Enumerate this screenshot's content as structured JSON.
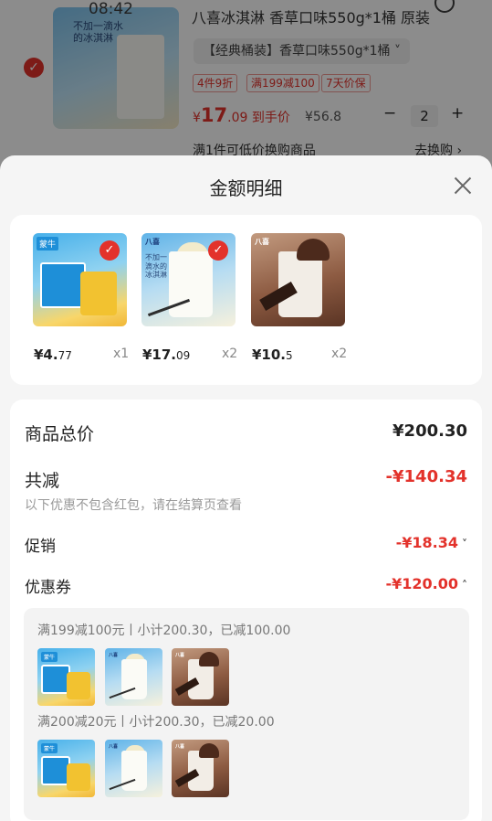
{
  "status_bar": {
    "time": "08:42"
  },
  "background_cart": {
    "product_title": "八喜冰淇淋 香草口味550g*1桶 原装",
    "variant": "【经典桶装】香草口味550g*1桶",
    "tags": [
      "4件9折",
      "满199减100",
      "7天价保"
    ],
    "price_currency": "¥",
    "price_int": "17",
    "price_dec": ".09",
    "price_suffix": "到手价",
    "original_price": "¥56.8",
    "stepper_minus": "−",
    "quantity": "2",
    "stepper_plus": "+",
    "exchange_text": "满1件可低价换购商品",
    "exchange_link": "去换购 ›",
    "thumb_text": "不加一滴水的冰淇淋",
    "thumb_brand": "八喜"
  },
  "sheet": {
    "title": "金额明细",
    "products": [
      {
        "price_int": "¥4.",
        "price_dec": "77",
        "qty": "x1",
        "brand": "蒙牛"
      },
      {
        "price_int": "¥17.",
        "price_dec": "09",
        "qty": "x2",
        "brand": "八喜",
        "text": "不加一滴水的冰淇淋"
      },
      {
        "price_int": "¥10.",
        "price_dec": "5",
        "qty": "x2",
        "brand": "八喜"
      }
    ],
    "summary": {
      "total_label": "商品总价",
      "total_value": "¥200.30",
      "discount_label": "共减",
      "discount_value": "-¥140.34",
      "discount_note": "以下优惠不包含红包，请在结算页查看",
      "promo_label": "促销",
      "promo_value": "-¥18.34",
      "coupon_label": "优惠券",
      "coupon_value": "-¥120.00"
    },
    "coupons": [
      {
        "text": "满199减100元丨小计200.30，已减100.00"
      },
      {
        "text": "满200减20元丨小计200.30，已减20.00"
      }
    ]
  },
  "colors": {
    "accent_red": "#e3322b",
    "sheet_bg": "#f5f5f5"
  }
}
